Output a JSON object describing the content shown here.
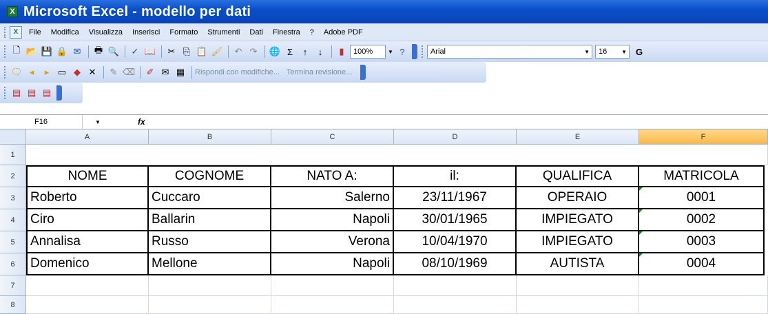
{
  "window": {
    "title": "Microsoft Excel - modello per dati",
    "app_icon": "X"
  },
  "menu": [
    "File",
    "Modifica",
    "Visualizza",
    "Inserisci",
    "Formato",
    "Strumenti",
    "Dati",
    "Finestra",
    "?",
    "Adobe PDF"
  ],
  "toolbar": {
    "zoom": "100%",
    "font": "Arial",
    "font_size": "16",
    "bold_label": "G",
    "review_reply": "Rispondi con modifiche...",
    "review_end": "Termina revisione..."
  },
  "formula_bar": {
    "name_box": "F16",
    "fx": "fx"
  },
  "columns": [
    "A",
    "B",
    "C",
    "D",
    "E",
    "F"
  ],
  "rows": [
    "1",
    "2",
    "3",
    "4",
    "5",
    "6",
    "7",
    "8"
  ],
  "headers": [
    "NOME",
    "COGNOME",
    "NATO A:",
    "il:",
    "QUALIFICA",
    "MATRICOLA"
  ],
  "records": [
    [
      "Roberto",
      "Cuccaro",
      "Salerno",
      "23/11/1967",
      "OPERAIO",
      "0001"
    ],
    [
      "Ciro",
      "Ballarin",
      "Napoli",
      "30/01/1965",
      "IMPIEGATO",
      "0002"
    ],
    [
      "Annalisa",
      "Russo",
      "Verona",
      "10/04/1970",
      "IMPIEGATO",
      "0003"
    ],
    [
      "Domenico",
      "Mellone",
      "Napoli",
      "08/10/1969",
      "AUTISTA",
      "0004"
    ]
  ],
  "colors": {
    "titlebar": "#0a4fc8",
    "active_column": "#f9b84a"
  }
}
